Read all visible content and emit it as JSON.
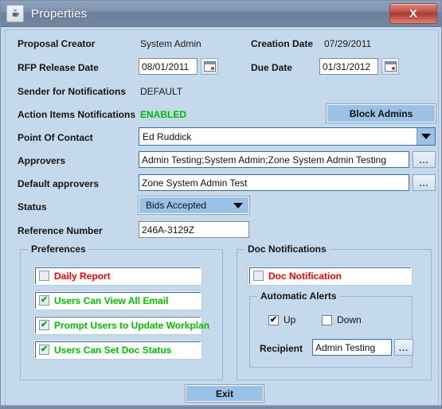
{
  "window": {
    "title": "Properties",
    "icon": "java-coffee-cup-icon",
    "close_label": "X",
    "body_color": "#c5d9ec",
    "titlebar_color": "#7288a6",
    "close_color": "#b0453a"
  },
  "form": {
    "proposal_creator": {
      "label": "Proposal Creator",
      "value": "System Admin"
    },
    "creation_date": {
      "label": "Creation Date",
      "value": "07/29/2011"
    },
    "rfp_release_date": {
      "label": "RFP Release Date",
      "value": "08/01/2011"
    },
    "due_date": {
      "label": "Due Date",
      "value": "01/31/2012"
    },
    "sender_for_notifications": {
      "label": "Sender for Notifications",
      "value": "DEFAULT"
    },
    "action_items_notifications": {
      "label": "Action Items Notifications",
      "value": "ENABLED",
      "value_color": "#00bb00"
    },
    "block_admins": {
      "label": "Block Admins"
    },
    "point_of_contact": {
      "label": "Point Of Contact",
      "value": "Ed Ruddick"
    },
    "approvers": {
      "label": "Approvers",
      "value": "Admin Testing;System Admin;Zone System Admin Testing",
      "browse_label": "..."
    },
    "default_approvers": {
      "label": "Default approvers",
      "value": "Zone System Admin Test",
      "browse_label": "..."
    },
    "status": {
      "label": "Status",
      "value": "Bids Accepted"
    },
    "reference_number": {
      "label": "Reference Number",
      "value": "246A-3129Z"
    }
  },
  "preferences": {
    "title": "Preferences",
    "items": [
      {
        "label": "Daily Report",
        "checked": false,
        "color": "#ff0000"
      },
      {
        "label": "Users Can View All Email",
        "checked": true,
        "color": "#00c000"
      },
      {
        "label": "Prompt Users to Update Workplan",
        "checked": true,
        "color": "#00c000"
      },
      {
        "label": "Users Can Set Doc Status",
        "checked": true,
        "color": "#00c000"
      }
    ]
  },
  "doc_notifications": {
    "title": "Doc Notifications",
    "doc_notification": {
      "label": "Doc Notification",
      "checked": false,
      "color": "#ff0000"
    },
    "automatic_alerts": {
      "title": "Automatic Alerts",
      "up": {
        "label": "Up",
        "checked": true
      },
      "down": {
        "label": "Down",
        "checked": false
      },
      "recipient": {
        "label": "Recipient",
        "value": "Admin Testing",
        "browse_label": "..."
      }
    }
  },
  "footer": {
    "exit_label": "Exit"
  }
}
